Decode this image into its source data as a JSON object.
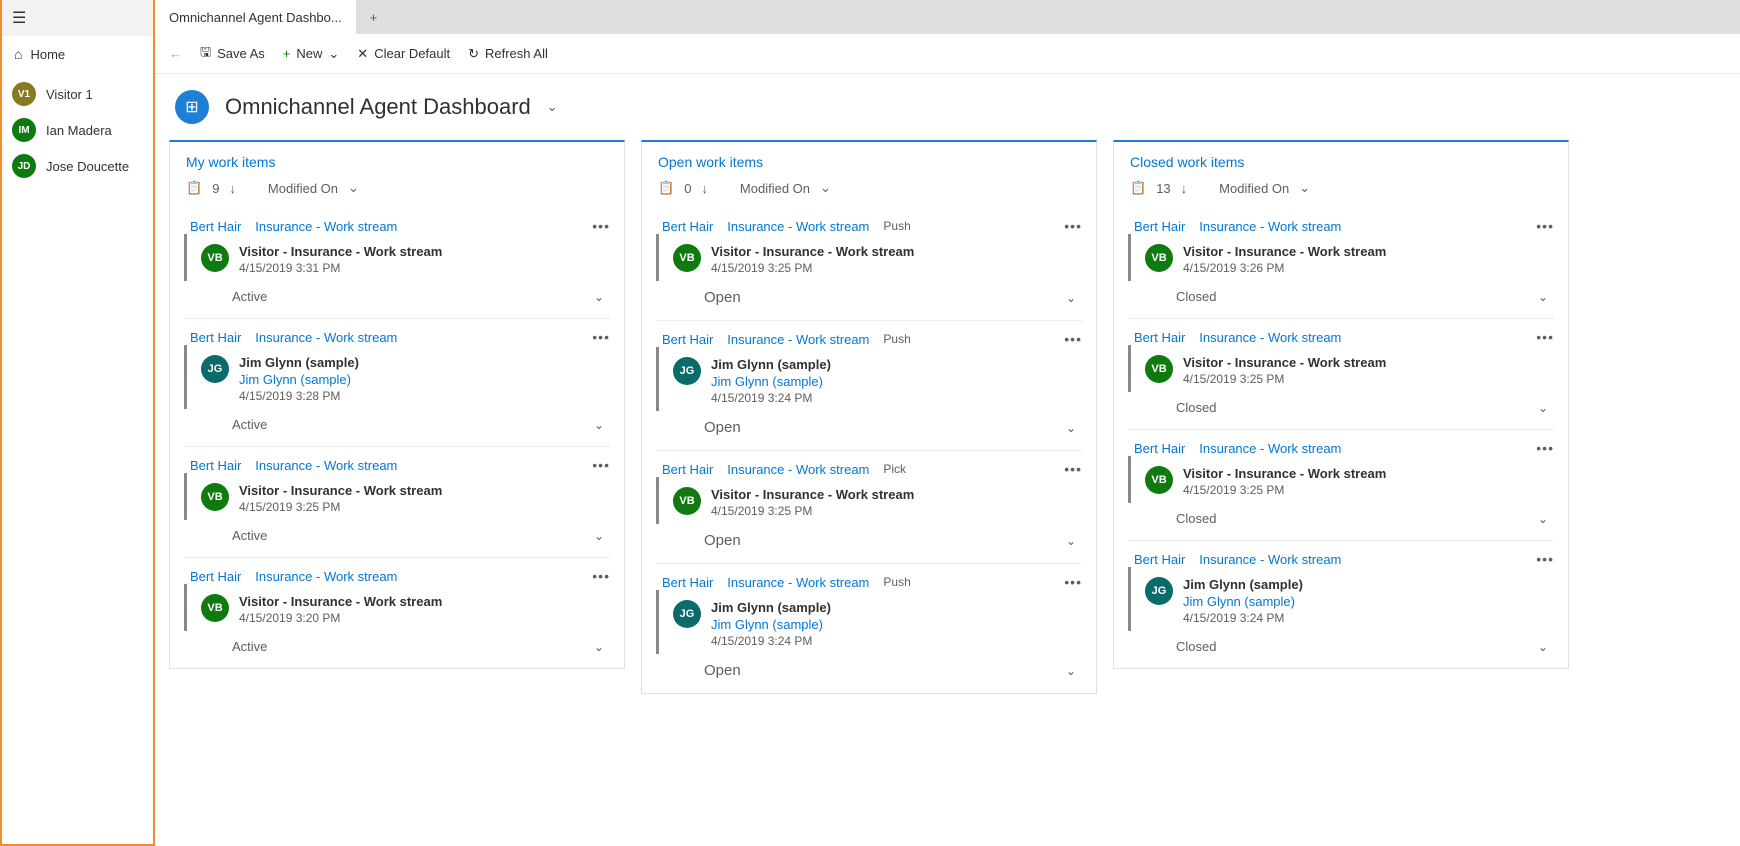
{
  "sidebar": {
    "home_label": "Home",
    "visitors": [
      {
        "initials": "V1",
        "name": "Visitor 1",
        "bg": "#8a7a1f"
      },
      {
        "initials": "IM",
        "name": "Ian Madera",
        "bg": "#0f7a0f"
      },
      {
        "initials": "JD",
        "name": "Jose Doucette",
        "bg": "#0f7a0f"
      }
    ]
  },
  "tabs": {
    "active_tab": "Omnichannel Agent Dashbo..."
  },
  "toolbar": {
    "save_as": "Save As",
    "new": "New",
    "clear_default": "Clear Default",
    "refresh_all": "Refresh All"
  },
  "page": {
    "title": "Omnichannel Agent Dashboard"
  },
  "columns": [
    {
      "title": "My work items",
      "count": "9",
      "sort": "Modified On",
      "cards": [
        {
          "owner": "Bert Hair",
          "stream": "Insurance - Work stream",
          "tag": "",
          "initials": "VB",
          "bg": "#0f7a0f",
          "title": "Visitor - Insurance - Work stream",
          "sublink": "",
          "date": "4/15/2019 3:31 PM",
          "status": "Active"
        },
        {
          "owner": "Bert Hair",
          "stream": "Insurance - Work stream",
          "tag": "",
          "initials": "JG",
          "bg": "#0b6a6a",
          "title": "Jim Glynn (sample)",
          "sublink": "Jim Glynn (sample)",
          "date": "4/15/2019 3:28 PM",
          "status": "Active"
        },
        {
          "owner": "Bert Hair",
          "stream": "Insurance - Work stream",
          "tag": "",
          "initials": "VB",
          "bg": "#0f7a0f",
          "title": "Visitor - Insurance - Work stream",
          "sublink": "",
          "date": "4/15/2019 3:25 PM",
          "status": "Active"
        },
        {
          "owner": "Bert Hair",
          "stream": "Insurance - Work stream",
          "tag": "",
          "initials": "VB",
          "bg": "#0f7a0f",
          "title": "Visitor - Insurance - Work stream",
          "sublink": "",
          "date": "4/15/2019 3:20 PM",
          "status": "Active"
        }
      ]
    },
    {
      "title": "Open work items",
      "count": "0",
      "sort": "Modified On",
      "cards": [
        {
          "owner": "Bert Hair",
          "stream": "Insurance - Work stream",
          "tag": "Push",
          "initials": "VB",
          "bg": "#0f7a0f",
          "title": "Visitor - Insurance - Work stream",
          "sublink": "",
          "date": "4/15/2019 3:25 PM",
          "status": "Open"
        },
        {
          "owner": "Bert Hair",
          "stream": "Insurance - Work stream",
          "tag": "Push",
          "initials": "JG",
          "bg": "#0b6a6a",
          "title": "Jim Glynn (sample)",
          "sublink": "Jim Glynn (sample)",
          "date": "4/15/2019 3:24 PM",
          "status": "Open"
        },
        {
          "owner": "Bert Hair",
          "stream": "Insurance - Work stream",
          "tag": "Pick",
          "initials": "VB",
          "bg": "#0f7a0f",
          "title": "Visitor - Insurance - Work stream",
          "sublink": "",
          "date": "4/15/2019 3:25 PM",
          "status": "Open"
        },
        {
          "owner": "Bert Hair",
          "stream": "Insurance - Work stream",
          "tag": "Push",
          "initials": "JG",
          "bg": "#0b6a6a",
          "title": "Jim Glynn (sample)",
          "sublink": "Jim Glynn (sample)",
          "date": "4/15/2019 3:24 PM",
          "status": "Open"
        }
      ]
    },
    {
      "title": "Closed work items",
      "count": "13",
      "sort": "Modified On",
      "cards": [
        {
          "owner": "Bert Hair",
          "stream": "Insurance - Work stream",
          "tag": "",
          "initials": "VB",
          "bg": "#0f7a0f",
          "title": "Visitor - Insurance - Work stream",
          "sublink": "",
          "date": "4/15/2019 3:26 PM",
          "status": "Closed"
        },
        {
          "owner": "Bert Hair",
          "stream": "Insurance - Work stream",
          "tag": "",
          "initials": "VB",
          "bg": "#0f7a0f",
          "title": "Visitor - Insurance - Work stream",
          "sublink": "",
          "date": "4/15/2019 3:25 PM",
          "status": "Closed"
        },
        {
          "owner": "Bert Hair",
          "stream": "Insurance - Work stream",
          "tag": "",
          "initials": "VB",
          "bg": "#0f7a0f",
          "title": "Visitor - Insurance - Work stream",
          "sublink": "",
          "date": "4/15/2019 3:25 PM",
          "status": "Closed"
        },
        {
          "owner": "Bert Hair",
          "stream": "Insurance - Work stream",
          "tag": "",
          "initials": "JG",
          "bg": "#0b6a6a",
          "title": "Jim Glynn (sample)",
          "sublink": "Jim Glynn (sample)",
          "date": "4/15/2019 3:24 PM",
          "status": "Closed"
        }
      ]
    }
  ]
}
